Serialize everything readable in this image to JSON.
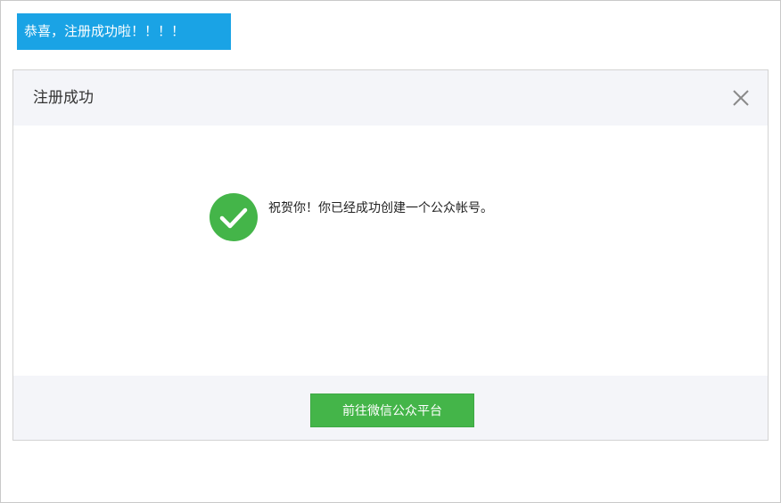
{
  "banner": {
    "text": "恭喜，注册成功啦！！！！"
  },
  "dialog": {
    "title": "注册成功",
    "close_icon": "close-icon",
    "success_icon": "checkmark-circle-icon",
    "message": "祝贺你！你已经成功创建一个公众帐号。",
    "primary_button_label": "前往微信公众平台"
  },
  "colors": {
    "banner_bg": "#1aa3e5",
    "success_green": "#44b549",
    "header_bg": "#f4f5f9"
  }
}
